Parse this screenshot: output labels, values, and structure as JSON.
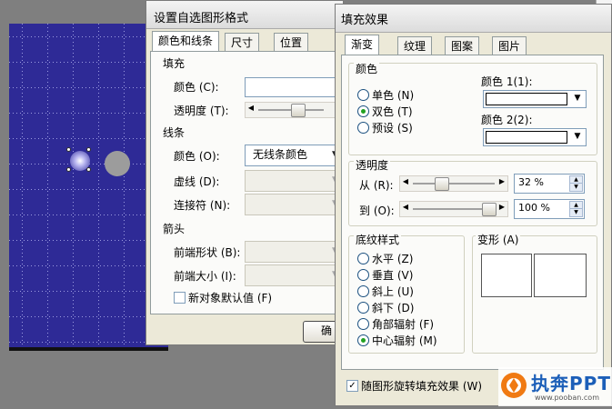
{
  "dialog1": {
    "title": "设置自选图形格式",
    "tabs": [
      "颜色和线条",
      "尺寸",
      "位置"
    ],
    "fill": {
      "section": "填充",
      "color_label": "颜色 (C):",
      "transparency_label": "透明度 (T):"
    },
    "line": {
      "section": "线条",
      "color_label": "颜色 (O):",
      "color_value": "无线条颜色",
      "dash_label": "虚线 (D):",
      "connector_label": "连接符 (N):"
    },
    "arrows": {
      "section": "箭头",
      "begin_style_label": "前端形状 (B):",
      "begin_size_label": "前端大小 (I):"
    },
    "default_checkbox": "新对象默认值 (F)",
    "ok_button": "确"
  },
  "dialog2": {
    "title": "填充效果",
    "tabs": [
      "渐变",
      "纹理",
      "图案",
      "图片"
    ],
    "colors": {
      "section": "颜色",
      "options": [
        "单色 (N)",
        "双色 (T)",
        "预设 (S)"
      ],
      "selected": "双色 (T)",
      "color1_label": "颜色 1(1):",
      "color2_label": "颜色 2(2):"
    },
    "transparency": {
      "section": "透明度",
      "from_label": "从 (R):",
      "to_label": "到 (O):",
      "from_value": "32 %",
      "to_value": "100 %",
      "from_level": 0.32,
      "to_level": 1.0
    },
    "shading": {
      "section": "底纹样式",
      "options": [
        "水平 (Z)",
        "垂直 (V)",
        "斜上 (U)",
        "斜下 (D)",
        "角部辐射 (F)",
        "中心辐射 (M)"
      ],
      "selected": "中心辐射 (M)"
    },
    "variants_label": "变形 (A)",
    "rotate_checkbox": "随图形旋转填充效果 (W)"
  },
  "logo": {
    "brand": "执奔PPT",
    "url": "www.pooban.com"
  },
  "colors": {
    "slide": "#2e2a96",
    "accent_radio": "#21a121"
  }
}
